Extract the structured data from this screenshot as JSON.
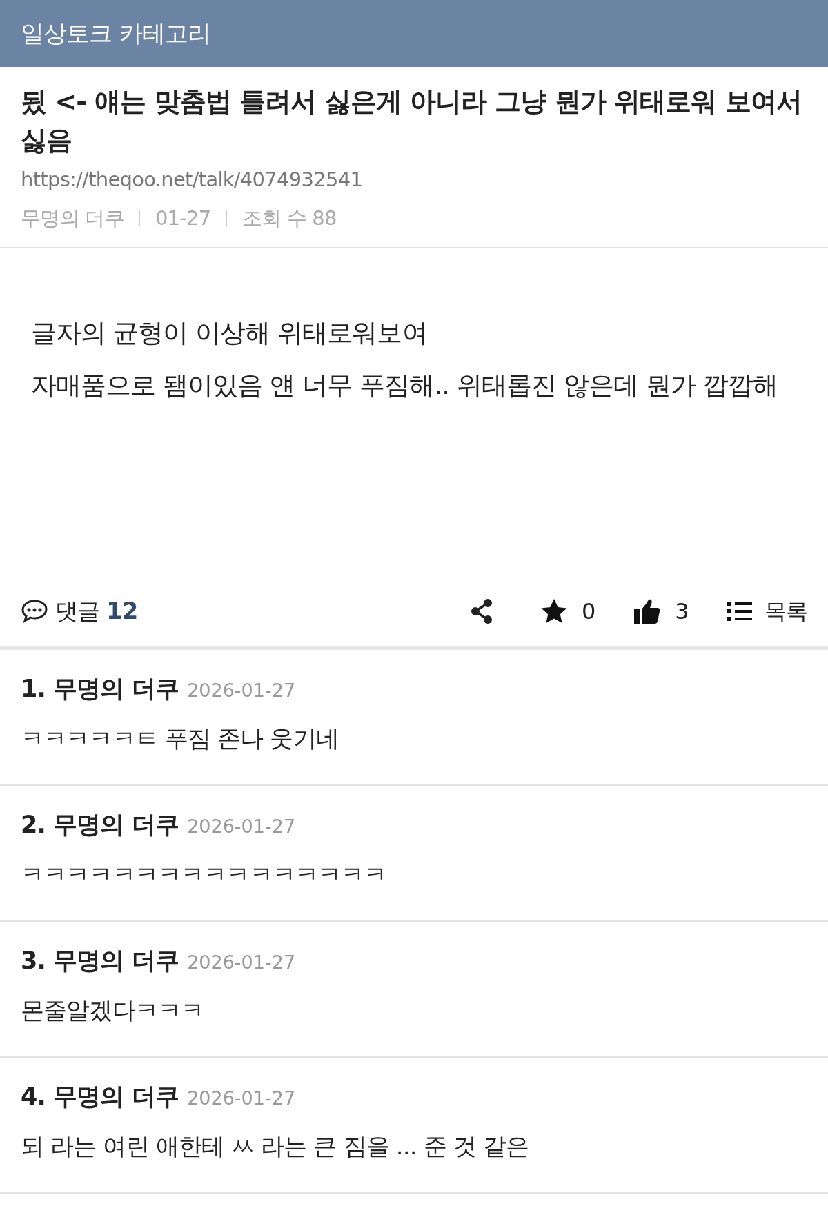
{
  "header": {
    "title": "일상토크 카테고리"
  },
  "post": {
    "title": "됬 <- 얘는 맞춤법 틀려서 싫은게 아니라 그냥 뭔가 위태로워 보여서 싫음",
    "url": "https://theqoo.net/talk/4074932541",
    "author": "무명의 더쿠",
    "date": "01-27",
    "views": "조회 수 88",
    "body": [
      "글자의 균형이 이상해 위태로워보여",
      "자매품으로 됌이있음 얜 너무 푸짐해.. 위태롭진 않은데 뭔가 깝깝해"
    ]
  },
  "toolbar": {
    "comments_label": "댓글",
    "comments_count": "12",
    "stars": "0",
    "likes": "3",
    "list_label": "목록"
  },
  "comments": [
    {
      "number": "1.",
      "author": "무명의 더쿠",
      "date": "2026-01-27",
      "text": "ㅋㅋㅋㅋㅋㅌ 푸짐 존나 웃기네"
    },
    {
      "number": "2.",
      "author": "무명의 더쿠",
      "date": "2026-01-27",
      "text": "ㅋㅋㅋㅋㅋㅋㅋㅋㅋㅋㅋㅋㅋㅋㅋㅋ"
    },
    {
      "number": "3.",
      "author": "무명의 더쿠",
      "date": "2026-01-27",
      "text": "몬줄알겠다ㅋㅋㅋ"
    },
    {
      "number": "4.",
      "author": "무명의 더쿠",
      "date": "2026-01-27",
      "text": "되 라는 여린 애한테 ㅆ 라는 큰 짐을 ... 준 것 같은"
    }
  ]
}
